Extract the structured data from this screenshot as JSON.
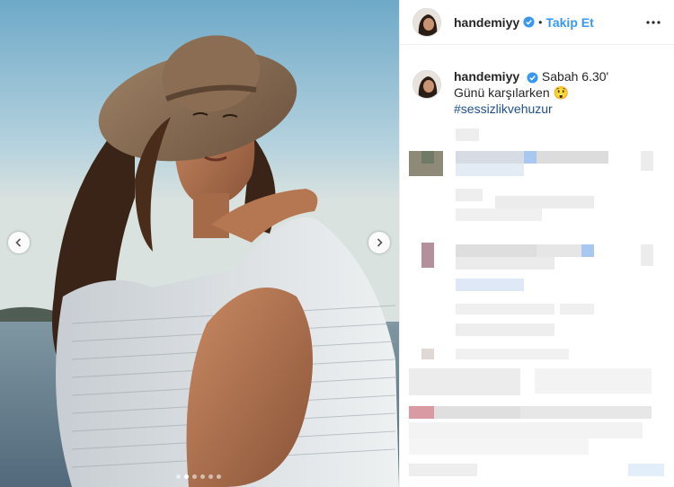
{
  "post": {
    "carousel": {
      "slide_count": 6,
      "active_index": 1
    }
  },
  "header": {
    "username": "handemiyy",
    "separator": "•",
    "follow_label": "Takip Et"
  },
  "caption": {
    "username": "handemiyy",
    "line1": "Sabah 6.30'",
    "line2": "Günü karşılarken",
    "emoji": "😲",
    "hashtag": "#sessizlikvehuzur"
  },
  "icons": {
    "verified": "verified-badge-icon",
    "more": "more-options-icon",
    "prev": "chevron-left-icon",
    "next": "chevron-right-icon"
  },
  "colors": {
    "follow_blue": "#3897f0",
    "hashtag": "#1f4f8f",
    "verified_blue": "#3897f0"
  }
}
